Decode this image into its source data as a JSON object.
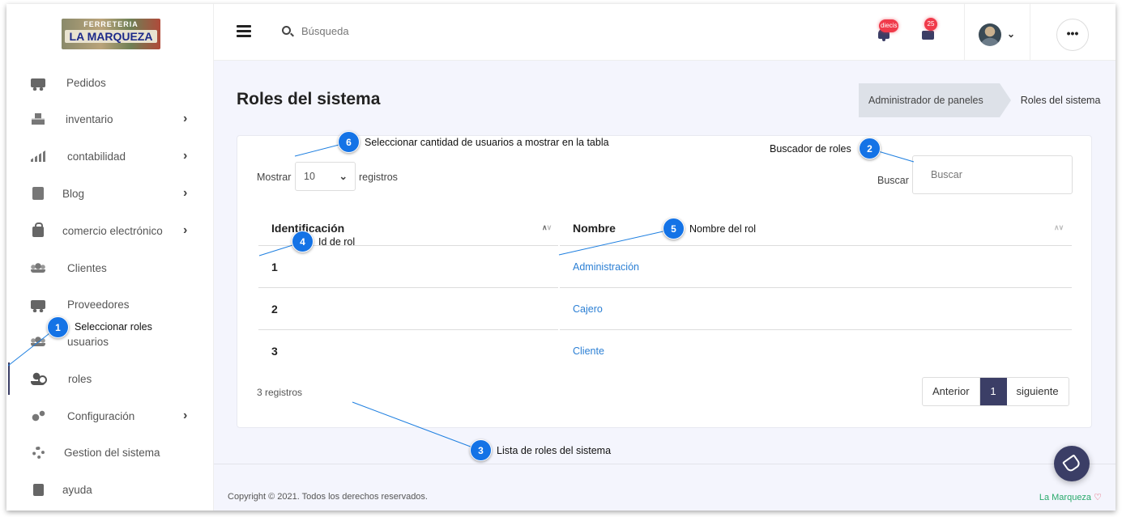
{
  "logo": {
    "line1": "FERRETERIA",
    "line2": "LA MARQUEZA"
  },
  "sidebar": {
    "items": [
      {
        "label": "Pedidos",
        "icon": "truck-icon",
        "chevron": false
      },
      {
        "label": "inventario",
        "icon": "boxes-icon",
        "chevron": true
      },
      {
        "label": "contabilidad",
        "icon": "signal-icon",
        "chevron": true
      },
      {
        "label": "Blog",
        "icon": "document-icon",
        "chevron": true
      },
      {
        "label": "comercio electrónico",
        "icon": "shopping-bag-icon",
        "chevron": true
      },
      {
        "label": "Clientes",
        "icon": "users-icon",
        "chevron": false
      },
      {
        "label": "Proveedores",
        "icon": "truck-icon",
        "chevron": false
      },
      {
        "label": "usuarios",
        "icon": "user-icon",
        "chevron": false
      },
      {
        "label": "roles",
        "icon": "user-gear-icon",
        "chevron": false,
        "active": true
      },
      {
        "label": "Configuración",
        "icon": "cogs-icon",
        "chevron": true
      },
      {
        "label": "Gestion del sistema",
        "icon": "cog-icon",
        "chevron": false
      },
      {
        "label": "ayuda",
        "icon": "book-icon",
        "chevron": false
      }
    ],
    "chevron": "›"
  },
  "header": {
    "search_placeholder": "Búsqueda",
    "notifications_badge": "diecis",
    "messages_badge": "25",
    "user_chevron": "⌄",
    "more": "•••"
  },
  "page": {
    "title": "Roles del sistema",
    "breadcrumb": [
      "Administrador de paneles",
      "Roles del sistema"
    ]
  },
  "table_controls": {
    "show_label": "Mostrar",
    "show_value": "10",
    "records_label": "registros",
    "search_label": "Buscar",
    "search_placeholder": "Buscar"
  },
  "table": {
    "columns": [
      "Identificación",
      "Nombre"
    ],
    "rows": [
      {
        "id": "1",
        "name": "Administración"
      },
      {
        "id": "2",
        "name": "Cajero"
      },
      {
        "id": "3",
        "name": "Cliente"
      }
    ],
    "count": "3 registros"
  },
  "pagination": {
    "prev": "Anterior",
    "page": "1",
    "next": "siguiente"
  },
  "footer": {
    "copyright": "Copyright © 2021. Todos los derechos reservados.",
    "brand": "La Marqueza",
    "heart": "♡"
  },
  "callouts": [
    {
      "num": "1",
      "text": "Seleccionar roles"
    },
    {
      "num": "2",
      "text": "Buscador de roles"
    },
    {
      "num": "3",
      "text": "Lista de roles del sistema"
    },
    {
      "num": "4",
      "text": "Id de rol"
    },
    {
      "num": "5",
      "text": "Nombre del rol"
    },
    {
      "num": "6",
      "text": "Seleccionar cantidad de usuarios a mostrar en la tabla"
    }
  ],
  "colors": {
    "primary": "#3b3e66",
    "link": "#2b7fd4",
    "callout": "#1473e6",
    "badge": "#f03a4a",
    "brand": "#29a96b"
  }
}
